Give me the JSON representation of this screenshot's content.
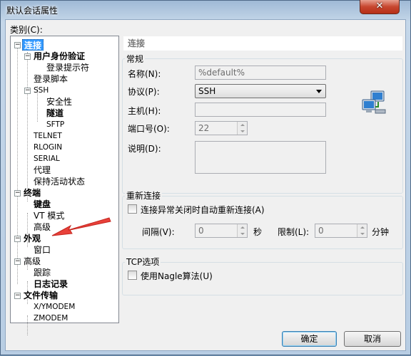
{
  "window": {
    "title": "默认会话属性",
    "close_glyph": "✕"
  },
  "category_label": "类别(C):",
  "tree": {
    "items": [
      {
        "label": "连接"
      },
      {
        "label": "用户身份验证"
      },
      {
        "label": "登录提示符"
      },
      {
        "label": "登录脚本"
      },
      {
        "label": "SSH"
      },
      {
        "label": "安全性"
      },
      {
        "label": "隧道"
      },
      {
        "label": "SFTP"
      },
      {
        "label": "TELNET"
      },
      {
        "label": "RLOGIN"
      },
      {
        "label": "SERIAL"
      },
      {
        "label": "代理"
      },
      {
        "label": "保持活动状态"
      },
      {
        "label": "终端"
      },
      {
        "label": "键盘"
      },
      {
        "label": "VT 模式"
      },
      {
        "label": "高级"
      },
      {
        "label": "外观"
      },
      {
        "label": "窗口"
      },
      {
        "label": "高级"
      },
      {
        "label": "跟踪"
      },
      {
        "label": "日志记录"
      },
      {
        "label": "文件传输"
      },
      {
        "label": "X/YMODEM"
      },
      {
        "label": "ZMODEM"
      }
    ],
    "toggle_glyph": "−"
  },
  "section_title": "连接",
  "general": {
    "title": "常规",
    "name_label": "名称(N):",
    "name_value": "%default%",
    "protocol_label": "协议(P):",
    "protocol_value": "SSH",
    "host_label": "主机(H):",
    "host_value": "",
    "port_label": "端口号(O):",
    "port_value": "22",
    "desc_label": "说明(D):",
    "desc_value": ""
  },
  "reconnect": {
    "title": "重新连接",
    "checkbox_label": "连接异常关闭时自动重新连接(A)",
    "interval_label": "间隔(V):",
    "interval_value": "0",
    "interval_unit": "秒",
    "limit_label": "限制(L):",
    "limit_value": "0",
    "limit_unit": "分钟"
  },
  "tcp": {
    "title": "TCP选项",
    "nagle_label": "使用Nagle算法(U)"
  },
  "buttons": {
    "ok": "确定",
    "cancel": "取消"
  },
  "icons": {
    "network": "network-computers-icon"
  },
  "colors": {
    "selection": "#3399ff",
    "arrow": "#e8413a"
  }
}
